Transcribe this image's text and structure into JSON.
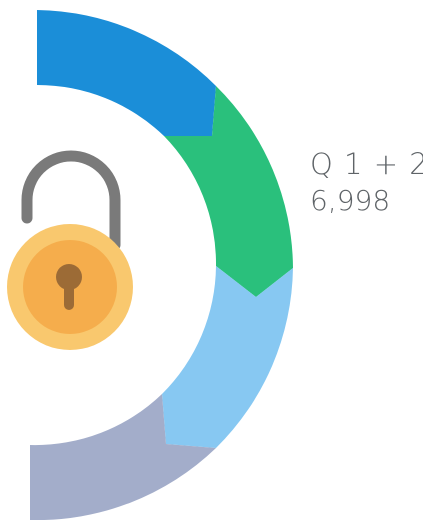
{
  "label": {
    "title": "Q 1 + 2",
    "value": "6,998"
  },
  "ring_segments": [
    {
      "color": "#1b8ed8"
    },
    {
      "color": "#2ac07c"
    },
    {
      "color": "#87c8f2"
    },
    {
      "color": "#a3adca"
    }
  ],
  "icons": {
    "lock": "unlocked-padlock-icon",
    "lock_colors": {
      "body_outer": "#f9c86e",
      "body_inner": "#f5ad4c",
      "keyhole": "#9c6b36",
      "shackle": "#7a7a7a"
    }
  }
}
